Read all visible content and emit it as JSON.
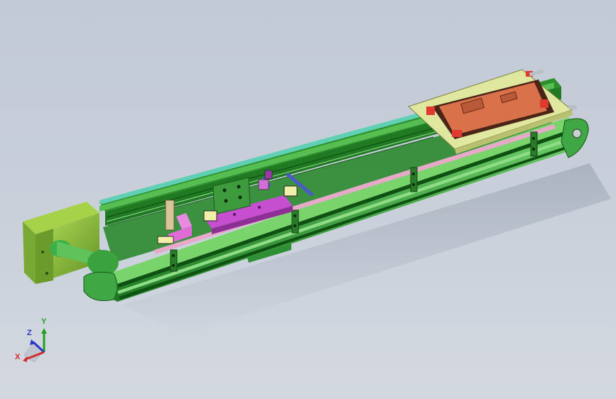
{
  "viewport": {
    "background_top": "#c2cad6",
    "background_bottom": "#d3d8e0"
  },
  "triad": {
    "x_label": "X",
    "y_label": "Y",
    "z_label": "Z",
    "x_color": "#d22a2a",
    "y_color": "#23a023",
    "z_color": "#2a36c8"
  },
  "model": {
    "frame_color": "#2f9b2f",
    "frame_light": "#6fd06a",
    "frame_dark": "#186f1c",
    "motor_color": "#8fc63a",
    "belt_color": "#e6a9c8",
    "carriage_color": "#c54fcf",
    "fixture_color": "#e0e8a0",
    "pcb_color": "#d9724a",
    "guard_color": "#5fd0b4"
  }
}
